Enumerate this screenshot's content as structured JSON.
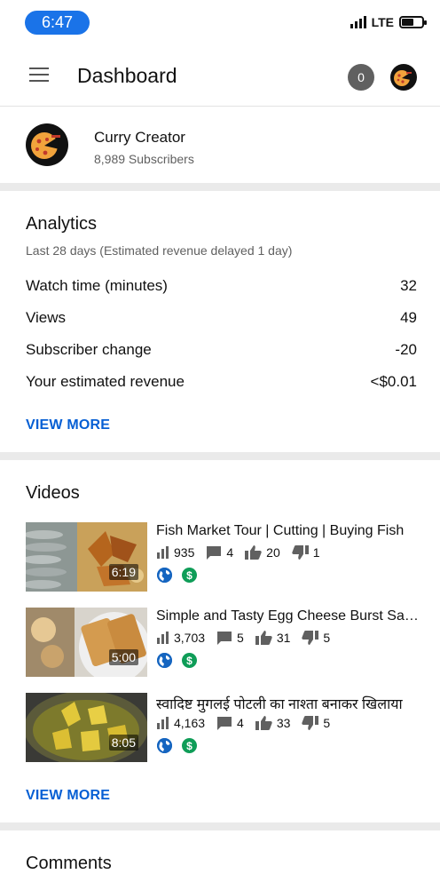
{
  "status_bar": {
    "time": "6:47",
    "network": "LTE",
    "battery_level": 0.6
  },
  "app_bar": {
    "title": "Dashboard",
    "notification_count": "0"
  },
  "channel": {
    "name": "Curry Creator",
    "subscribers": "8,989 Subscribers"
  },
  "analytics": {
    "title": "Analytics",
    "subtitle": "Last 28 days (Estimated revenue delayed 1 day)",
    "metrics": [
      {
        "label": "Watch time (minutes)",
        "value": "32"
      },
      {
        "label": "Views",
        "value": "49"
      },
      {
        "label": "Subscriber change",
        "value": "-20"
      },
      {
        "label": "Your estimated revenue",
        "value": "<$0.01"
      }
    ],
    "view_more": "VIEW MORE"
  },
  "videos": {
    "title": "Videos",
    "items": [
      {
        "title": "Fish Market Tour | Cutting | Buying Fish",
        "duration": "6:19",
        "views": "935",
        "comments": "4",
        "likes": "20",
        "dislikes": "1"
      },
      {
        "title": "Simple and Tasty Egg Cheese Burst Sandwich",
        "duration": "5:00",
        "views": "3,703",
        "comments": "5",
        "likes": "31",
        "dislikes": "5"
      },
      {
        "title": "स्वादिष्ट मुगलई पोटली का नाश्ता बनाकर खिलाया",
        "duration": "8:05",
        "views": "4,163",
        "comments": "4",
        "likes": "33",
        "dislikes": "5"
      }
    ],
    "view_more": "VIEW MORE"
  },
  "comments": {
    "title": "Comments"
  }
}
